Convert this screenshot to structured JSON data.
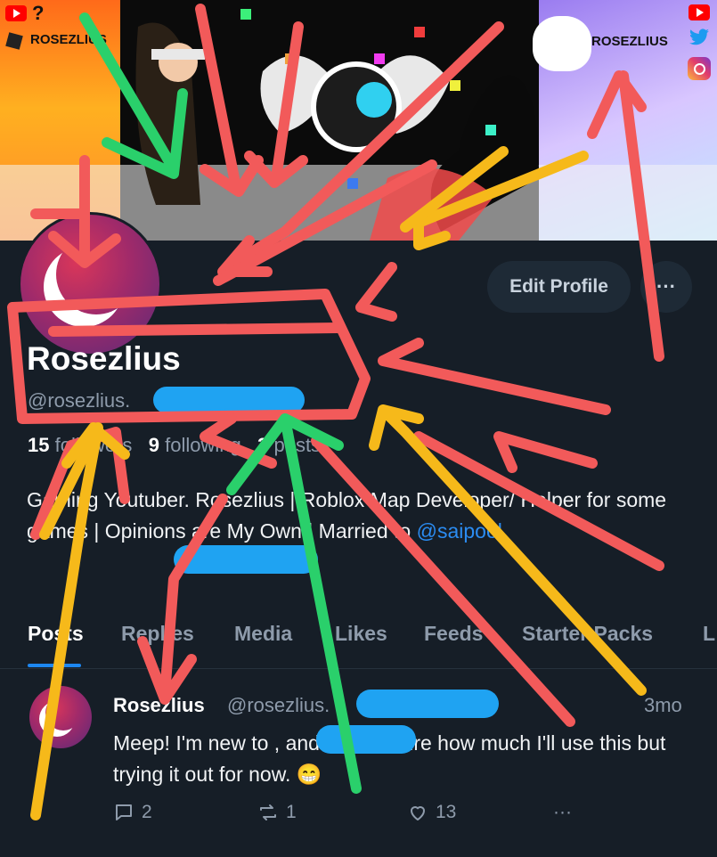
{
  "banner": {
    "left_tag": "ROSEZLIUS",
    "right_tag": "ROSEZLIUS",
    "question_mark": "?"
  },
  "profile": {
    "edit_button": "Edit Profile",
    "more_button": "···",
    "display_name": "Rosezlius",
    "handle": "@rosezlius.",
    "stats": {
      "followers_count": "15",
      "followers_label": "followers",
      "following_count": "9",
      "following_label": "following",
      "posts_count": "3",
      "posts_label": "posts"
    },
    "bio_text": "Gaming Youtuber. Rosezlius | Roblox Map Developer/ Helper for some games | Opinions are My Own | Married to ",
    "bio_mention": "@saipool."
  },
  "tabs": [
    {
      "label": "Posts"
    },
    {
      "label": "Replies"
    },
    {
      "label": "Media"
    },
    {
      "label": "Likes"
    },
    {
      "label": "Feeds"
    },
    {
      "label": "Starter Packs"
    },
    {
      "label": "L"
    }
  ],
  "post": {
    "author": "Rosezlius",
    "handle": "@rosezlius.",
    "time": "3mo",
    "text": "Meep! I'm new to                 , and I'm not sure how much I'll use this but trying it out for now. 😁",
    "replies": "2",
    "reposts": "1",
    "likes": "13",
    "more": "···"
  },
  "colors": {
    "background": "#161e27",
    "accent": "#1d87f0",
    "muted": "#8e9bab",
    "scribble_red": "#f25a5a",
    "scribble_yellow": "#f6b91a",
    "scribble_green": "#2ad06b",
    "redaction_blue": "#1fa3f2"
  },
  "icons": [
    "youtube-icon",
    "roblox-icon",
    "twitter-icon",
    "instagram-icon",
    "reply-icon",
    "repost-icon",
    "heart-icon",
    "more-icon"
  ]
}
